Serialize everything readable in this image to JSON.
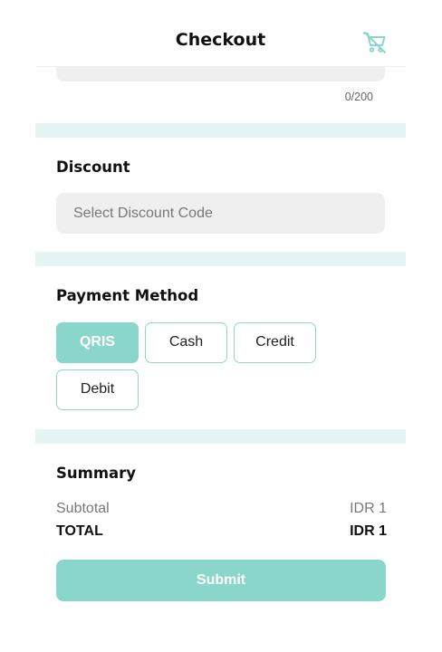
{
  "header": {
    "title": "Checkout",
    "cart_icon": "cart-off-icon"
  },
  "notes": {
    "counter": "0/200"
  },
  "discount": {
    "heading": "Discount",
    "placeholder": "Select Discount Code"
  },
  "payment": {
    "heading": "Payment Method",
    "options": [
      {
        "label": "QRIS",
        "selected": true
      },
      {
        "label": "Cash",
        "selected": false
      },
      {
        "label": "Credit",
        "selected": false
      },
      {
        "label": "Debit",
        "selected": false
      }
    ]
  },
  "summary": {
    "heading": "Summary",
    "subtotal_label": "Subtotal",
    "subtotal_value": "IDR 1",
    "total_label": "TOTAL",
    "total_value": "IDR 1"
  },
  "submit_label": "Submit",
  "colors": {
    "accent": "#8ad6ca",
    "band": "#e5f5f3",
    "field": "#efefef"
  }
}
